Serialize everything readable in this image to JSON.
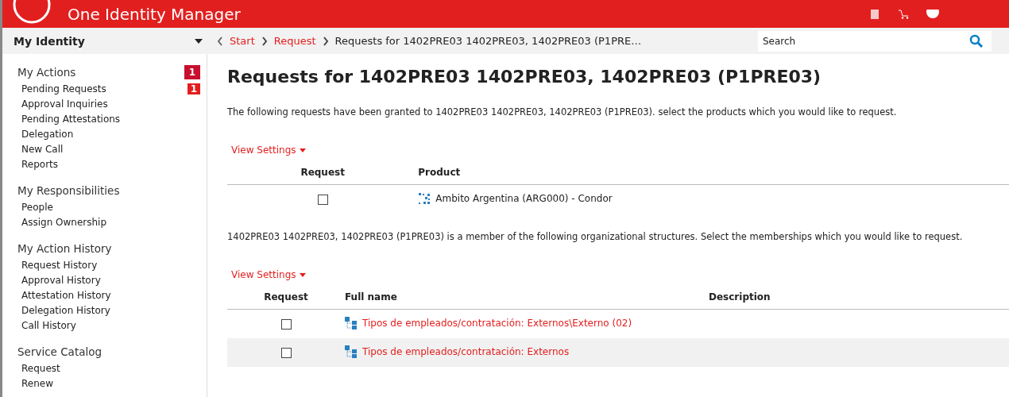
{
  "header": {
    "title": "One Identity Manager"
  },
  "topbar": {
    "menu_label": "My Identity",
    "breadcrumb": [
      {
        "label": "Start",
        "link": true
      },
      {
        "label": "Request",
        "link": true
      },
      {
        "label": "Requests for 1402PRE03 1402PRE03, 1402PRE03 (P1PRE…",
        "link": false
      }
    ],
    "search": {
      "placeholder": "Search"
    }
  },
  "sidebar": {
    "sections": [
      {
        "title": "My Actions",
        "badge": "1",
        "items": [
          {
            "label": "Pending Requests",
            "badge": "1"
          },
          {
            "label": "Approval Inquiries"
          },
          {
            "label": "Pending Attestations"
          },
          {
            "label": "Delegation"
          },
          {
            "label": "New Call"
          },
          {
            "label": "Reports"
          }
        ]
      },
      {
        "title": "My Responsibilities",
        "items": [
          {
            "label": "People"
          },
          {
            "label": "Assign Ownership"
          }
        ]
      },
      {
        "title": "My Action History",
        "items": [
          {
            "label": "Request History"
          },
          {
            "label": "Approval History"
          },
          {
            "label": "Attestation History"
          },
          {
            "label": "Delegation History"
          },
          {
            "label": "Call History"
          }
        ]
      },
      {
        "title": "Service Catalog",
        "items": [
          {
            "label": "Request"
          },
          {
            "label": "Renew"
          }
        ]
      }
    ]
  },
  "main": {
    "title": "Requests for 1402PRE03 1402PRE03, 1402PRE03 (P1PRE03)",
    "sections": [
      {
        "intro": "The following requests have been granted to 1402PRE03 1402PRE03, 1402PRE03 (P1PRE03). select the products which you would like to request.",
        "view_settings": "View Settings",
        "columns": [
          "Request",
          "Product"
        ],
        "rows": [
          {
            "checked": false,
            "kind": "product",
            "name": "Ambito Argentina (ARG000) - Condor",
            "link": false,
            "shaded": false
          }
        ]
      },
      {
        "intro": "1402PRE03 1402PRE03, 1402PRE03 (P1PRE03) is a member of the following organizational structures. Select the memberships which you would like to request.",
        "view_settings": "View Settings",
        "columns": [
          "Request",
          "Full name",
          "Description"
        ],
        "rows": [
          {
            "checked": false,
            "kind": "org",
            "name": "Tipos de empleados/contratación: Externos\\Externo (02)",
            "link": true,
            "shaded": false
          },
          {
            "checked": false,
            "kind": "org",
            "name": "Tipos de empleados/contratación: Externos",
            "link": true,
            "shaded": true
          }
        ]
      }
    ]
  }
}
